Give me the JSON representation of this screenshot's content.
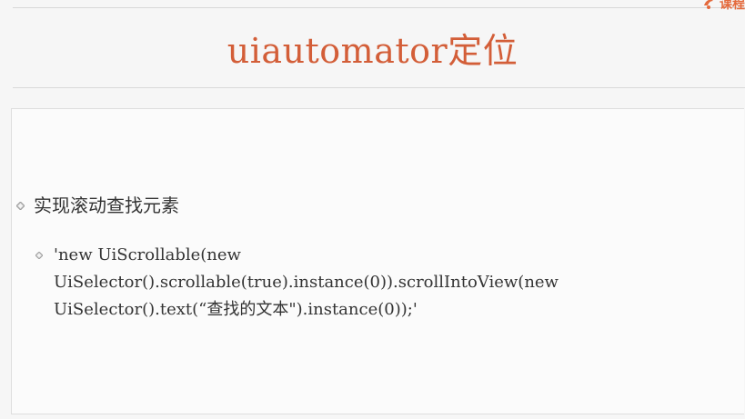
{
  "slide": {
    "title": "uiautomator定位",
    "brand_text": "课程",
    "bullet": "实现滚动查找元素",
    "sub_lines": [
      "'new UiScrollable(new",
      "UiSelector().scrollable(true).instance(0)).scrollIntoView(new",
      "UiSelector().text(“查找的文本\").instance(0));'"
    ]
  },
  "colors": {
    "title": "#d35e38",
    "brand": "#e35b2a",
    "text": "#333333",
    "background": "#f6f6f6",
    "content_bg": "#fbfbfb"
  },
  "icons": {
    "bullet": "diamond-bullet-icon",
    "sub_bullet": "small-diamond-bullet-icon",
    "brand_logo": "brand-logo-icon"
  }
}
